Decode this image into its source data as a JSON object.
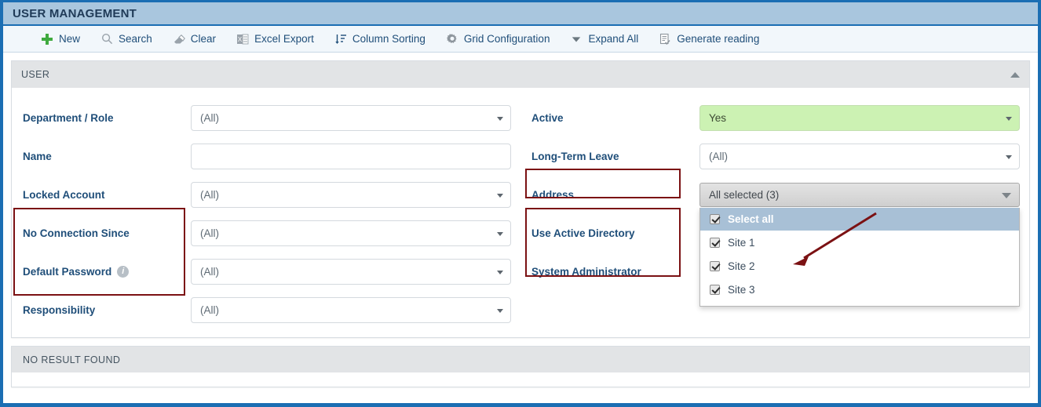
{
  "window": {
    "title": "USER MANAGEMENT"
  },
  "toolbar": {
    "items": [
      {
        "label": "New",
        "icon": "plus-icon"
      },
      {
        "label": "Search",
        "icon": "search-icon"
      },
      {
        "label": "Clear",
        "icon": "eraser-icon"
      },
      {
        "label": "Excel Export",
        "icon": "excel-icon"
      },
      {
        "label": "Column Sorting",
        "icon": "sort-icon"
      },
      {
        "label": "Grid Configuration",
        "icon": "gear-icon"
      },
      {
        "label": "Expand All",
        "icon": "chevron-down-icon"
      },
      {
        "label": "Generate reading",
        "icon": "document-check-icon"
      }
    ]
  },
  "panel": {
    "title": "USER",
    "collapse_icon": "chevron-up-icon",
    "left_fields": [
      {
        "label": "Department / Role",
        "type": "select",
        "value": "(All)",
        "info": false
      },
      {
        "label": "Name",
        "type": "text",
        "value": "",
        "placeholder": "",
        "info": false
      },
      {
        "label": "Locked Account",
        "type": "select",
        "value": "(All)",
        "info": false
      },
      {
        "label": "No Connection Since",
        "type": "select",
        "value": "(All)",
        "info": false
      },
      {
        "label": "Default Password",
        "type": "select",
        "value": "(All)",
        "info": true,
        "info_icon": "info-icon"
      },
      {
        "label": "Responsibility",
        "type": "select",
        "value": "(All)",
        "info": false
      }
    ],
    "right_fields": [
      {
        "label": "Active",
        "type": "select",
        "value": "Yes",
        "highlight": true
      },
      {
        "label": "Long-Term Leave",
        "type": "select",
        "value": "(All)",
        "highlight": false
      },
      {
        "label": "Address",
        "type": "multiselect",
        "value": "All selected (3)",
        "highlight": false
      },
      {
        "label": "Use Active Directory",
        "type": "none",
        "value": "",
        "highlight": false
      },
      {
        "label": "System Administrator",
        "type": "none",
        "value": "",
        "highlight": false
      }
    ],
    "address_dropdown": {
      "select_all_label": "Select all",
      "select_all_checked": true,
      "options": [
        {
          "label": "Site 1",
          "checked": true
        },
        {
          "label": "Site 2",
          "checked": true
        },
        {
          "label": "Site 3",
          "checked": true
        }
      ]
    }
  },
  "results": {
    "message": "NO RESULT FOUND"
  },
  "annotations": {
    "arrow_color": "#7b1113",
    "box_color": "#7b1113"
  }
}
